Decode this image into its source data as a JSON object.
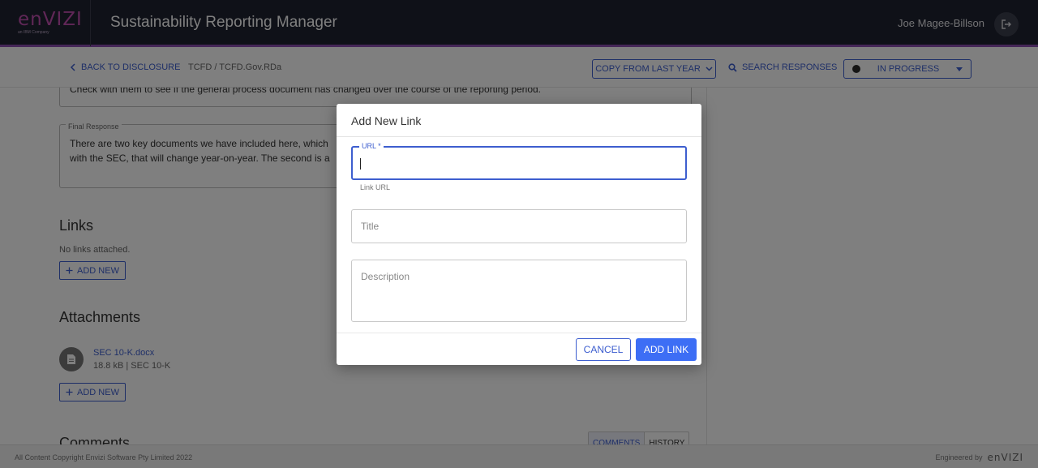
{
  "header": {
    "logo_text": "enVIZI",
    "logo_subtext": "an IBM Company",
    "app_title": "Sustainability Reporting Manager",
    "user_name": "Joe Magee-Billson",
    "logout_icon": "logout-icon"
  },
  "subheader": {
    "back_label": "BACK TO DISCLOSURE",
    "breadcrumb": "TCFD  /  TCFD.Gov.RDa",
    "copy_label": "COPY FROM LAST YEAR",
    "search_label": "SEARCH RESPONSES",
    "status_label": "IN PROGRESS"
  },
  "main": {
    "note_text": "Check with them to see if the general process document has changed over the course of the reporting period.",
    "final_response_legend": "Final Response",
    "final_response_line1": "There are two key documents we have included here, which",
    "final_response_line2": "with the SEC, that will change year-on-year. The second is a",
    "links_heading": "Links",
    "links_empty": "No links attached.",
    "add_new_label": "ADD NEW",
    "attachments_heading": "Attachments",
    "attachment_name": "SEC 10-K.docx",
    "attachment_meta": "18.8 kB | SEC 10-K",
    "comments_heading": "Comments",
    "tab_comments": "COMMENTS",
    "tab_history": "HISTORY"
  },
  "footer": {
    "copyright": "All Content Copyright Envizi Software Pty Limited 2022",
    "engineered_by": "Engineered by",
    "footer_logo": "enVIZI"
  },
  "dialog": {
    "title": "Add New Link",
    "url_label": "URL *",
    "url_value": "",
    "url_helper": "Link URL",
    "title_placeholder": "Title",
    "description_placeholder": "Description",
    "cancel_label": "CANCEL",
    "submit_label": "ADD LINK"
  },
  "colors": {
    "accent": "#3d5ecf",
    "primary_button": "#3d6ef5",
    "header_bg": "#1f2230",
    "header_accent": "#8b4fb0"
  }
}
